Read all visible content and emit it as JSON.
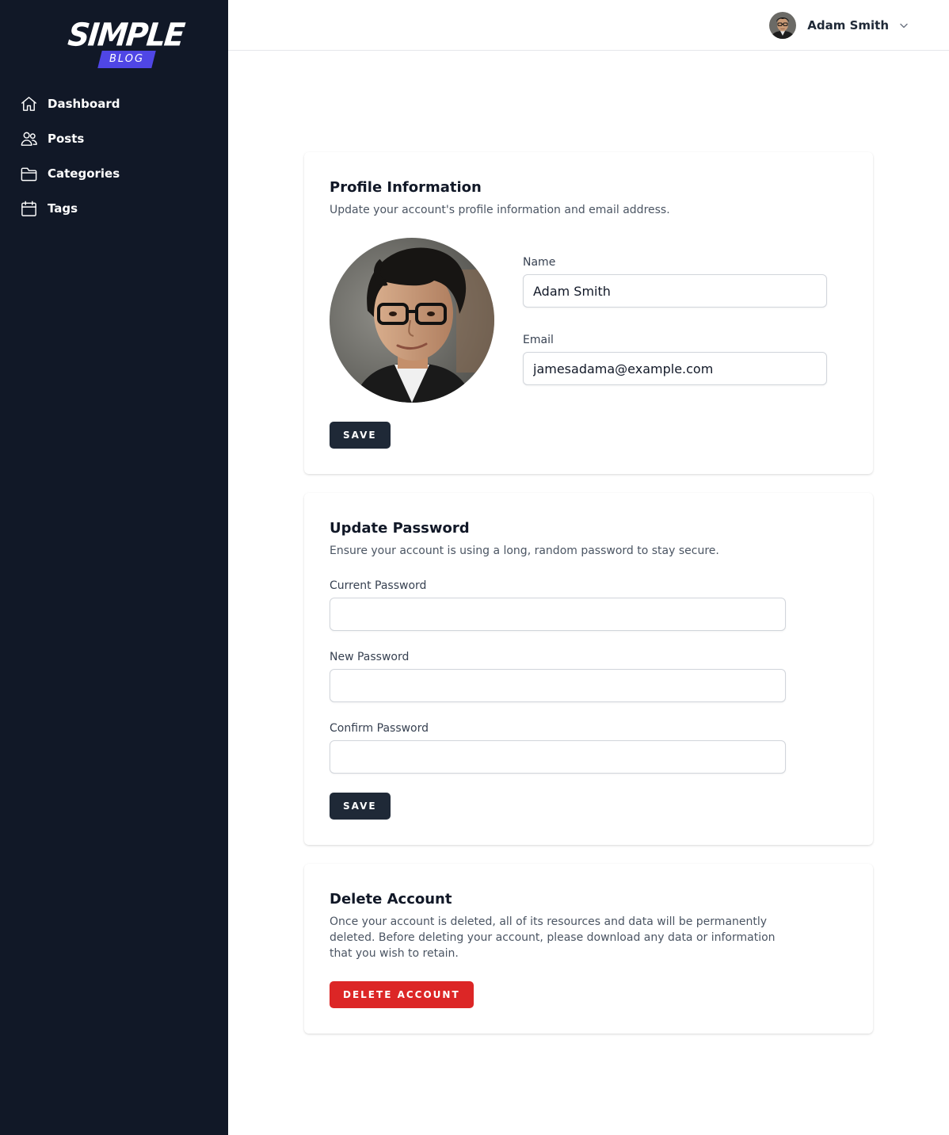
{
  "brand": {
    "logo_top": "SIMPLE",
    "logo_bottom": "BLOG",
    "accent": "#4f46e5"
  },
  "sidebar": {
    "items": [
      {
        "label": "Dashboard",
        "icon": "home-icon"
      },
      {
        "label": "Posts",
        "icon": "users-icon"
      },
      {
        "label": "Categories",
        "icon": "folder-icon"
      },
      {
        "label": "Tags",
        "icon": "calendar-icon"
      }
    ]
  },
  "header": {
    "user_name": "Adam Smith"
  },
  "profile": {
    "title": "Profile Information",
    "description": "Update your account's profile information and email address.",
    "name_label": "Name",
    "name_value": "Adam Smith",
    "email_label": "Email",
    "email_value": "jamesadama@example.com",
    "save_label": "SAVE"
  },
  "password": {
    "title": "Update Password",
    "description": "Ensure your account is using a long, random password to stay secure.",
    "current_label": "Current Password",
    "new_label": "New Password",
    "confirm_label": "Confirm Password",
    "save_label": "SAVE"
  },
  "delete": {
    "title": "Delete Account",
    "description": "Once your account is deleted, all of its resources and data will be permanently deleted. Before deleting your account, please download any data or information that you wish to retain.",
    "button_label": "DELETE ACCOUNT"
  },
  "colors": {
    "sidebar_bg": "#111827",
    "button_dark": "#1f2937",
    "danger": "#dc2626"
  }
}
